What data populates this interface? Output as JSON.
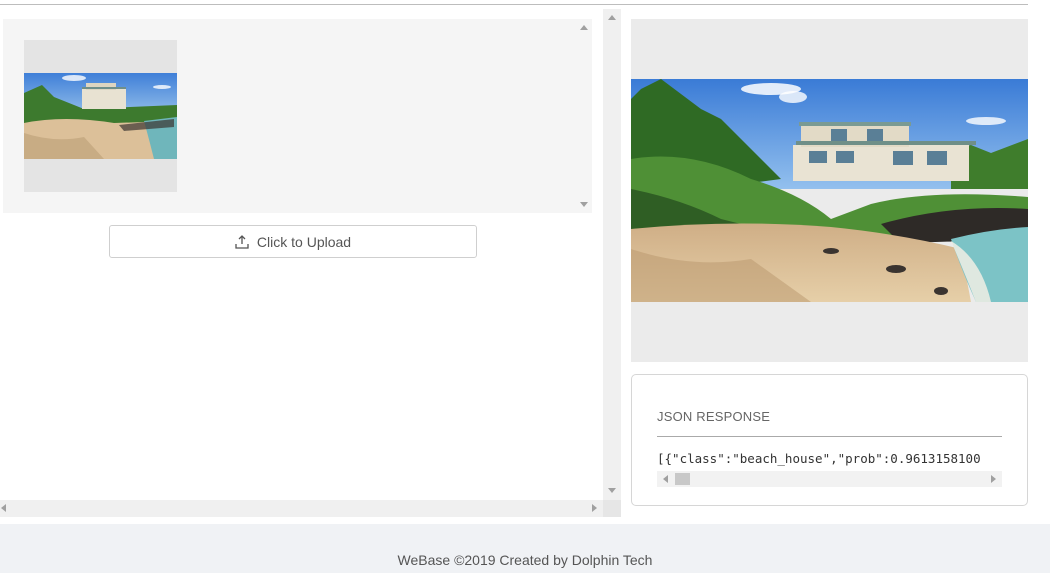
{
  "upload": {
    "button_label": "Click to Upload",
    "icon": "upload-icon"
  },
  "thumbnail": {
    "alt": "beach house thumbnail"
  },
  "preview": {
    "alt": "beach house preview"
  },
  "json_panel": {
    "title": "JSON RESPONSE",
    "response": "[{\"class\":\"beach_house\",\"prob\":0.9613158100"
  },
  "footer": {
    "text": "WeBase ©2019 Created by Dolphin Tech"
  },
  "colors": {
    "panel_bg": "#f5f5f5",
    "preview_bg": "#ebebeb",
    "footer_bg": "#f0f2f5"
  }
}
